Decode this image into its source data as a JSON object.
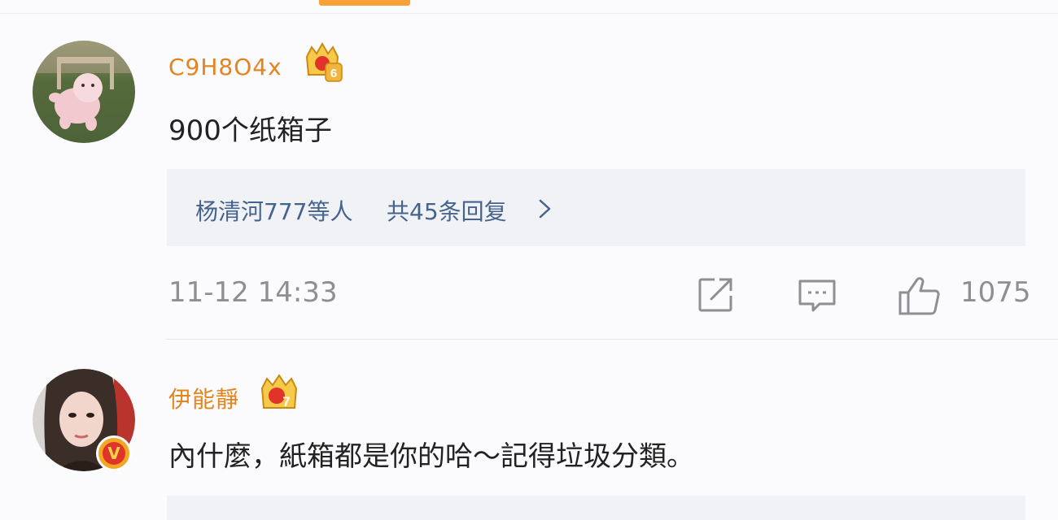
{
  "comments": [
    {
      "username": "C9H8O4x",
      "level": "6",
      "content": "900个纸箱子",
      "reply_users": "杨清河777等人",
      "reply_count": "共45条回复",
      "time": "11-12 14:33",
      "likes": "1075"
    },
    {
      "username": "伊能靜",
      "level": "7",
      "verified_mark": "V",
      "content": "內什麼，紙箱都是你的哈～記得垃圾分類。"
    }
  ],
  "icons": {
    "share": "share-icon",
    "comment": "comment-icon",
    "like": "thumbs-up-icon",
    "chevron": "chevron-right-icon",
    "crown": "crown-icon"
  },
  "colors": {
    "username": "#e2841f",
    "reply_link": "#45638f",
    "meta": "#8e8e93",
    "accent_tab": "#f7a136"
  }
}
